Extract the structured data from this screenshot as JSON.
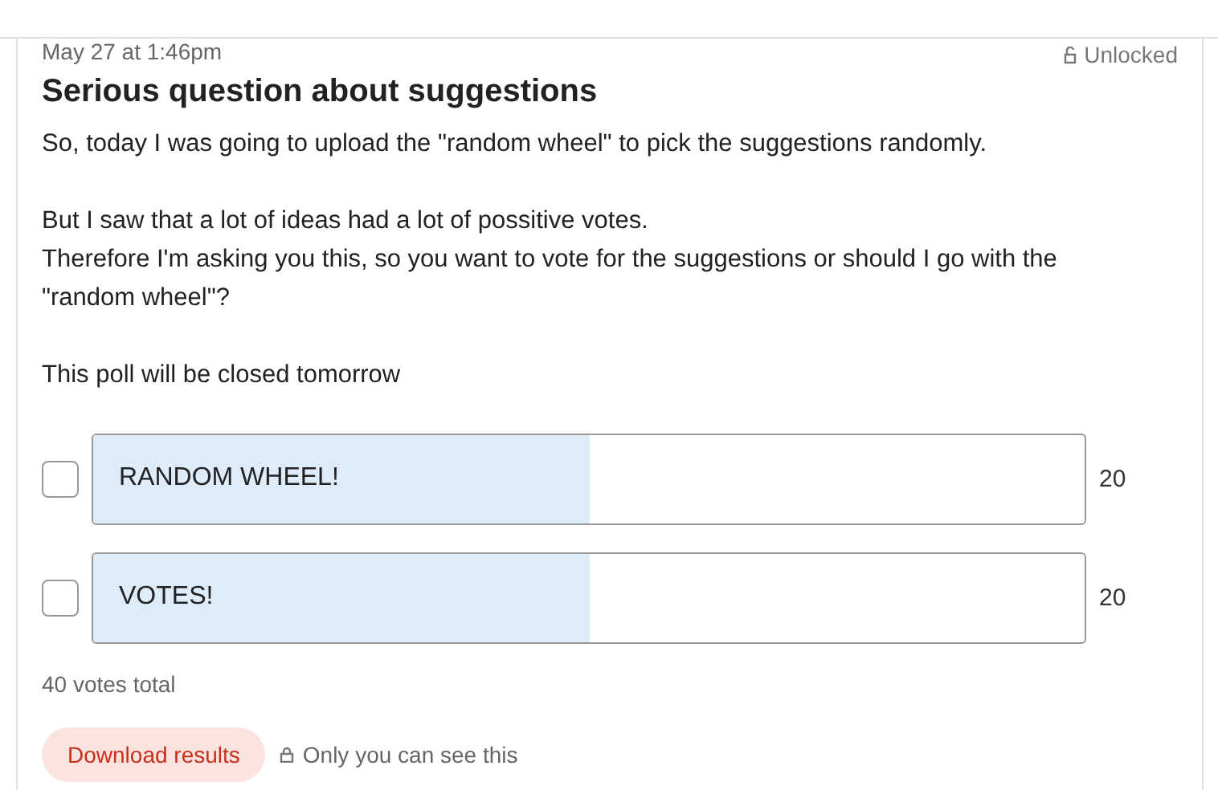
{
  "post": {
    "timestamp": "May 27 at 1:46pm",
    "lock_status": "Unlocked",
    "title": "Serious question about suggestions",
    "paragraphs": [
      [
        "So, today I was going to upload the \"random wheel\" to pick the suggestions randomly."
      ],
      [
        "But I saw that a lot of ideas had a lot of possitive votes.",
        "Therefore I'm asking you this, so you want to vote for the suggestions or should I go with the \"random wheel\"?"
      ],
      [
        "This poll will be closed tomorrow"
      ]
    ]
  },
  "poll": {
    "options": [
      {
        "label": "RANDOM WHEEL!",
        "checked": false,
        "level": 0.5,
        "count": "20"
      },
      {
        "label": "VOTES!",
        "checked": false,
        "level": 0.5,
        "count": "20"
      }
    ],
    "total": "40 votes total",
    "download_button": "Download results",
    "visibility_note": "Only you can see this"
  }
}
